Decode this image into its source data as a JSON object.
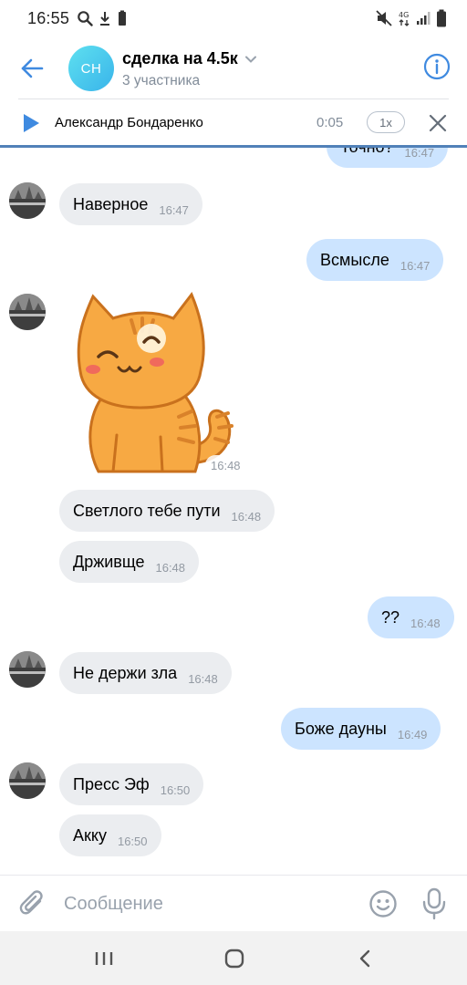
{
  "status_bar": {
    "time": "16:55"
  },
  "header": {
    "avatar_initials": "СН",
    "title": "сделка на 4.5к",
    "subtitle": "3 участника"
  },
  "player": {
    "name": "Александр Бондаренко",
    "time": "0:05",
    "speed": "1x"
  },
  "messages": [
    {
      "dir": "out",
      "text": "Точно?",
      "time": "16:47"
    },
    {
      "dir": "in",
      "text": "Наверное",
      "time": "16:47"
    },
    {
      "dir": "out",
      "text": "Всмысле",
      "time": "16:47"
    },
    {
      "dir": "in",
      "type": "sticker",
      "time": "16:48"
    },
    {
      "dir": "in",
      "text": "Светлого тебе пути",
      "time": "16:48"
    },
    {
      "dir": "in",
      "text": "Држивще",
      "time": "16:48"
    },
    {
      "dir": "out",
      "text": "??",
      "time": "16:48"
    },
    {
      "dir": "in",
      "text": "Не держи зла",
      "time": "16:48"
    },
    {
      "dir": "out",
      "text": "Боже дауны",
      "time": "16:49"
    },
    {
      "dir": "in",
      "text": "Пресс Эф",
      "time": "16:50"
    },
    {
      "dir": "in",
      "text": "Акку",
      "time": "16:50"
    }
  ],
  "composer": {
    "placeholder": "Сообщение"
  },
  "colors": {
    "accent": "#5181b8",
    "incoming_bubble": "#ebedf0",
    "outgoing_bubble": "#cce4ff",
    "avatar_gradient": [
      "#5ee0f0",
      "#39b4ea"
    ]
  },
  "icons": [
    "search-icon",
    "download-icon",
    "battery-saver-icon",
    "mute-icon",
    "4g-icon",
    "signal-icon",
    "battery-icon",
    "back-arrow-icon",
    "chevron-down-icon",
    "info-icon",
    "play-icon",
    "close-icon",
    "attach-icon",
    "emoji-icon",
    "mic-icon",
    "recent-apps-icon",
    "home-icon",
    "nav-back-icon"
  ]
}
